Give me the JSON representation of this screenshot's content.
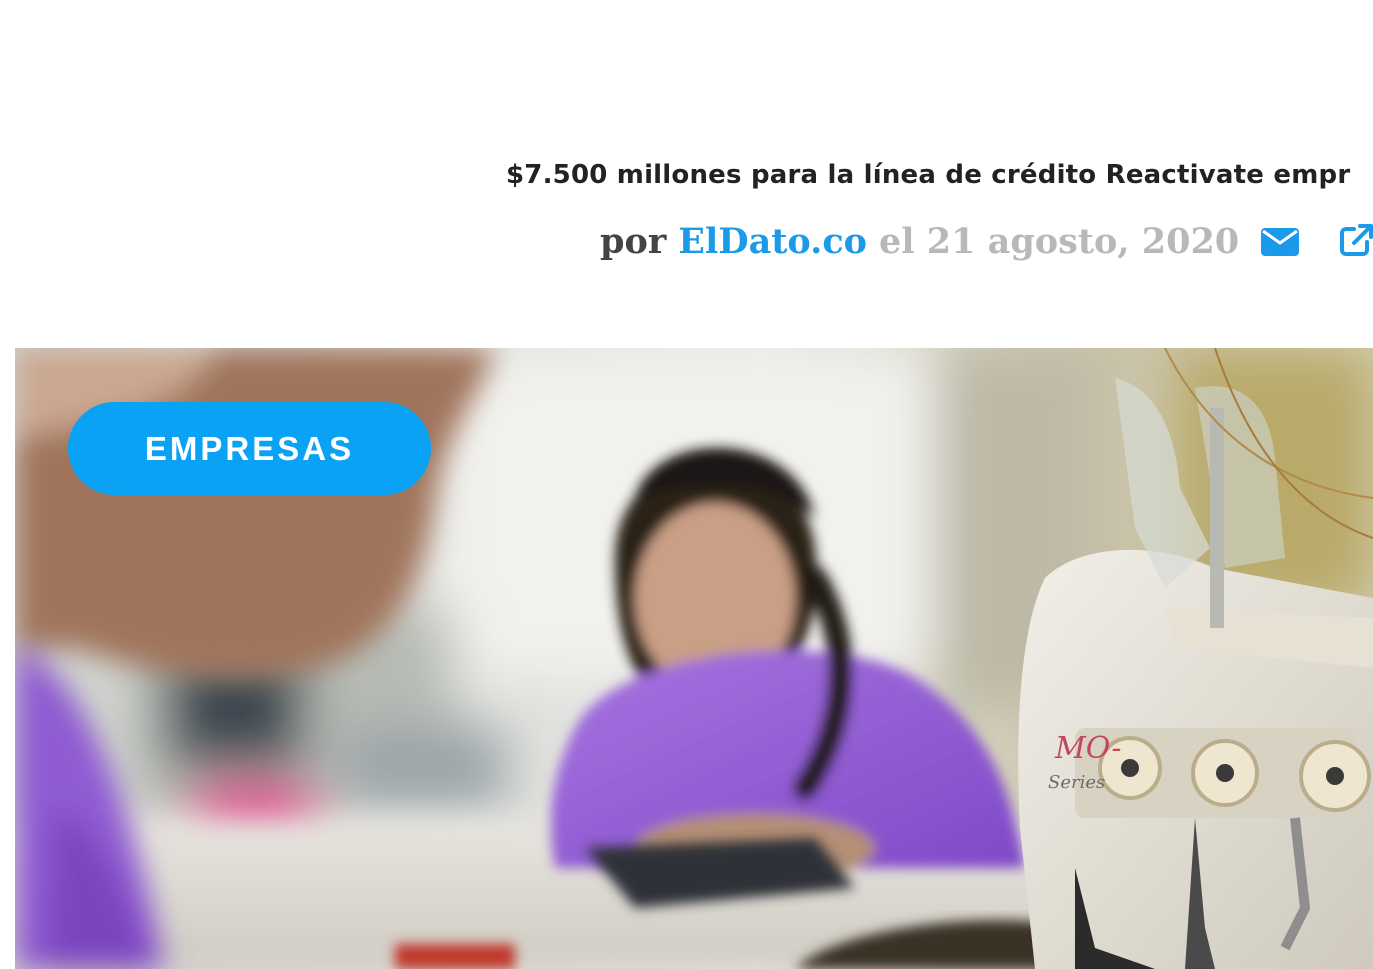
{
  "article": {
    "headline": "$7.500 millones para la línea de crédito Reactivate empr",
    "byline": {
      "prefix": "por",
      "author": "ElDato.co",
      "date_text": "el 21 agosto, 2020"
    },
    "actions": {
      "email_icon": "envelope-icon",
      "share_icon": "external-link-icon"
    },
    "category": "EMPRESAS",
    "hero_image": {
      "machine_label": "MO-",
      "machine_series": "Series"
    }
  },
  "colors": {
    "accent": "#0aa2f5",
    "author_link": "#1a9ae8",
    "meta_gray": "#b8b8b8",
    "text_dark": "#222222"
  }
}
